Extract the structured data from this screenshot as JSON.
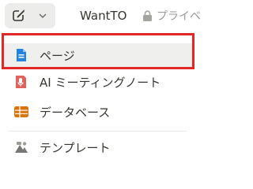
{
  "topbar": {
    "new_page_icon": "compose-icon",
    "menu_icon": "chevron-down-icon",
    "workspace_name": "WantTO",
    "privacy_icon": "lock-icon",
    "privacy_label": "プライベ"
  },
  "menu": {
    "items": [
      {
        "label": "ページ",
        "icon": "page-icon",
        "icon_color": "#2383e2"
      },
      {
        "label": "AI ミーティングノート",
        "icon": "ai-meeting-notes-icon",
        "icon_color": "#e16259"
      },
      {
        "label": "データベース",
        "icon": "database-icon",
        "icon_color": "#d9730d"
      },
      {
        "label": "テンプレート",
        "icon": "template-icon",
        "icon_color": "#787774"
      }
    ]
  },
  "highlight_color": "#e32626"
}
